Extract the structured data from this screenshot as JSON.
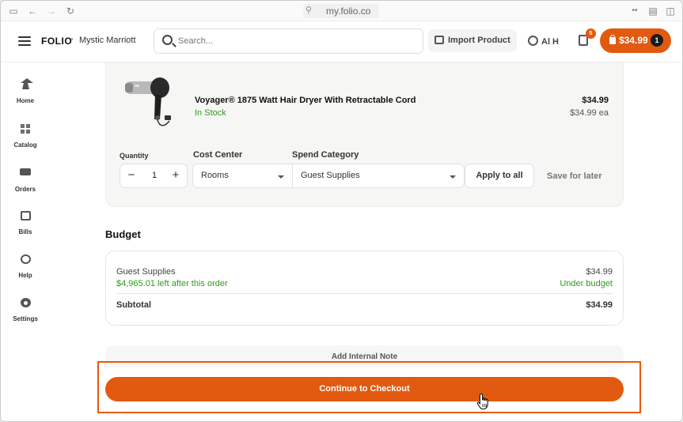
{
  "browser": {
    "url": "my.folio.co"
  },
  "header": {
    "brand": "FOLIO",
    "separator": "•",
    "organization": "Mystic Marriott",
    "search_placeholder": "Search...",
    "import_label": "Import Product",
    "user_label": "Al H",
    "notification_count": "5",
    "cart_amount": "$34.99",
    "cart_count": "1"
  },
  "sidebar": {
    "items": [
      {
        "label": "Home",
        "icon": "home-icon"
      },
      {
        "label": "Catalog",
        "icon": "catalog-icon"
      },
      {
        "label": "Orders",
        "icon": "truck-icon"
      },
      {
        "label": "Bills",
        "icon": "bills-icon"
      },
      {
        "label": "Help",
        "icon": "help-icon"
      },
      {
        "label": "Settings",
        "icon": "gear-icon"
      }
    ]
  },
  "product": {
    "name": "Voyager® 1875 Watt Hair Dryer With Retractable Cord",
    "stock": "In Stock",
    "price": "$34.99",
    "price_each": "$34.99 ea",
    "quantity_label": "Quantity",
    "quantity": "1",
    "minus": "−",
    "plus": "+",
    "cost_center_label": "Cost Center",
    "cost_center_value": "Rooms",
    "spend_category_label": "Spend Category",
    "spend_category_value": "Guest Supplies",
    "apply_label": "Apply to all",
    "save_label": "Save for later"
  },
  "budget": {
    "title": "Budget",
    "category": "Guest Supplies",
    "remaining": "$4,965.01 left after this order",
    "amount": "$34.99",
    "status": "Under budget",
    "subtotal_label": "Subtotal",
    "subtotal_value": "$34.99"
  },
  "footer": {
    "note_label": "Add Internal Note",
    "checkout_label": "Continue to Checkout"
  },
  "colors": {
    "accent": "#e25a0f",
    "success": "#2f9a1e",
    "highlight": "#e8590c"
  }
}
